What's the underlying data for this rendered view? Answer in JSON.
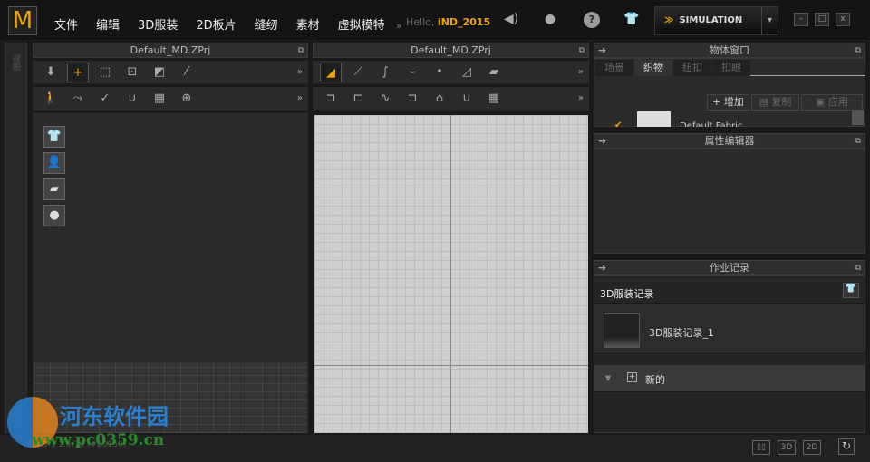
{
  "app": {
    "logo": "M",
    "menu": [
      "文件",
      "编辑",
      "3D服装",
      "2D板片",
      "缝纫",
      "素材",
      "虚拟模特"
    ],
    "more": "»",
    "hello": "Hello,",
    "user": "iND_2015",
    "simulation": "SIMULATION"
  },
  "left_strip": {
    "label": "视图"
  },
  "panel_3d": {
    "title": "Default_MD.ZPrj",
    "more": "»"
  },
  "panel_2d": {
    "title": "Default_MD.ZPrj",
    "more": "»"
  },
  "object_window": {
    "title": "物体窗口",
    "tabs": [
      "场景",
      "织物",
      "纽扣",
      "扣眼"
    ],
    "active_tab": "织物",
    "buttons": [
      "增加",
      "复制",
      "应用"
    ],
    "fabric": "Default Fabric"
  },
  "property_editor": {
    "title": "属性编辑器"
  },
  "history": {
    "title": "作业记录",
    "section": "3D服装记录",
    "items": [
      {
        "label": "3D服装记录_1"
      }
    ],
    "new_label": "新的"
  },
  "status": {
    "text": "V5.1.5.1 2.5.76  (#20150)",
    "buttons": [
      "3D",
      "2D"
    ]
  },
  "watermark": {
    "name": "河东软件园",
    "url": "www.pc0359.cn"
  },
  "colors": {
    "accent": "#f0a400",
    "bg": "#2b2b2b"
  }
}
